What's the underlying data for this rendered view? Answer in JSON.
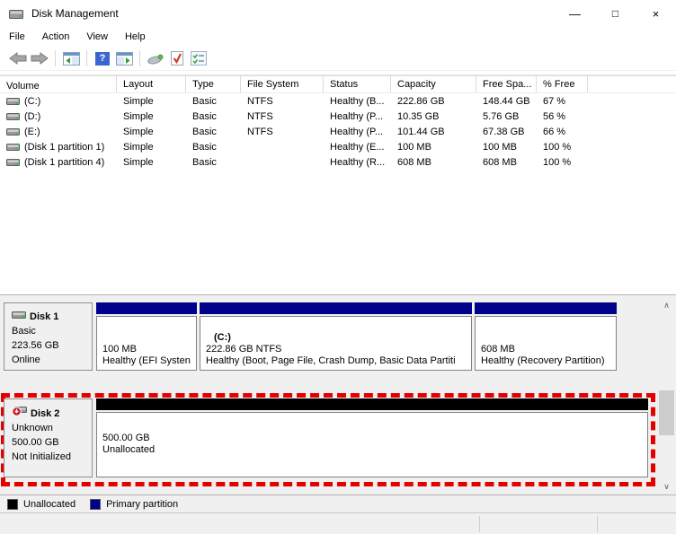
{
  "window": {
    "title": "Disk Management",
    "controls": {
      "minimize": "—",
      "maximize": "□",
      "close": "×"
    }
  },
  "menu": {
    "items": [
      "File",
      "Action",
      "View",
      "Help"
    ]
  },
  "toolbar": {
    "icons": [
      "back",
      "forward",
      "console-tree",
      "help",
      "action-pane",
      "popup-tool",
      "task-check",
      "task-list"
    ]
  },
  "volume_table": {
    "columns": [
      "Volume",
      "Layout",
      "Type",
      "File System",
      "Status",
      "Capacity",
      "Free Spa...",
      "% Free"
    ],
    "rows": [
      {
        "volume": "(C:)",
        "layout": "Simple",
        "type": "Basic",
        "fs": "NTFS",
        "status": "Healthy (B...",
        "capacity": "222.86 GB",
        "free": "148.44 GB",
        "pct": "67 %"
      },
      {
        "volume": "(D:)",
        "layout": "Simple",
        "type": "Basic",
        "fs": "NTFS",
        "status": "Healthy (P...",
        "capacity": "10.35 GB",
        "free": "5.76 GB",
        "pct": "56 %"
      },
      {
        "volume": "(E:)",
        "layout": "Simple",
        "type": "Basic",
        "fs": "NTFS",
        "status": "Healthy (P...",
        "capacity": "101.44 GB",
        "free": "67.38 GB",
        "pct": "66 %"
      },
      {
        "volume": "(Disk 1 partition 1)",
        "layout": "Simple",
        "type": "Basic",
        "fs": "",
        "status": "Healthy (E...",
        "capacity": "100 MB",
        "free": "100 MB",
        "pct": "100 %"
      },
      {
        "volume": "(Disk 1 partition 4)",
        "layout": "Simple",
        "type": "Basic",
        "fs": "",
        "status": "Healthy (R...",
        "capacity": "608 MB",
        "free": "608 MB",
        "pct": "100 %"
      }
    ]
  },
  "disks": [
    {
      "name": "Disk 1",
      "type": "Basic",
      "size": "223.56 GB",
      "status": "Online",
      "partitions": [
        {
          "title": "",
          "line1": "100 MB",
          "line2": "Healthy (EFI Systen",
          "color": "#00008b"
        },
        {
          "title": "(C:)",
          "line1": "222.86 GB NTFS",
          "line2": "Healthy (Boot, Page File, Crash Dump, Basic Data Partiti",
          "color": "#00008b"
        },
        {
          "title": "",
          "line1": "608 MB",
          "line2": "Healthy (Recovery Partition)",
          "color": "#00008b"
        }
      ]
    },
    {
      "name": "Disk 2",
      "type": "Unknown",
      "size": "500.00 GB",
      "status": "Not Initialized",
      "partitions": [
        {
          "title": "",
          "line1": "500.00 GB",
          "line2": "Unallocated",
          "color": "#000000"
        }
      ]
    }
  ],
  "legend": {
    "items": [
      {
        "label": "Unallocated",
        "color": "#000000"
      },
      {
        "label": "Primary partition",
        "color": "#00008b"
      }
    ]
  },
  "colors": {
    "primary_partition": "#00008b",
    "unallocated": "#000000",
    "highlight_red": "#e50000"
  }
}
